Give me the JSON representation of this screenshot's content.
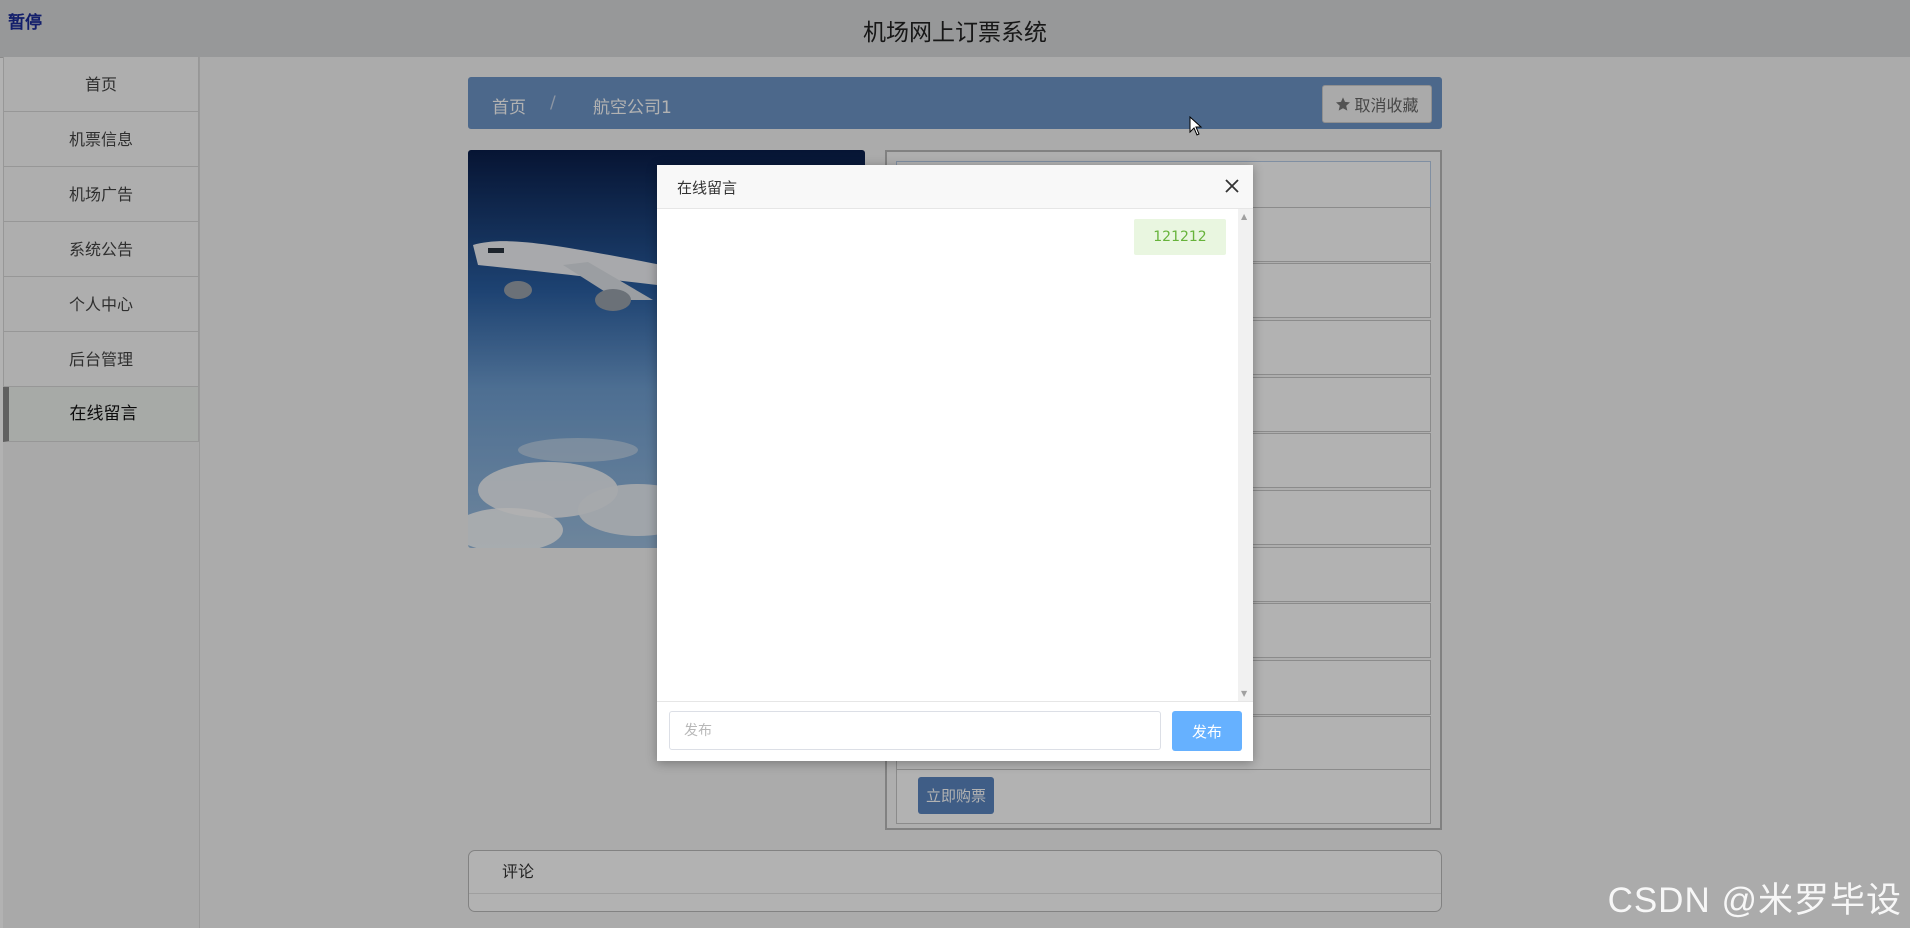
{
  "app": {
    "pause_label": "暂停",
    "title": "机场网上订票系统"
  },
  "sidebar": {
    "items": [
      {
        "label": "首页"
      },
      {
        "label": "机票信息"
      },
      {
        "label": "机场广告"
      },
      {
        "label": "系统公告"
      },
      {
        "label": "个人中心"
      },
      {
        "label": "后台管理"
      },
      {
        "label": "在线留言",
        "active": true
      }
    ]
  },
  "breadcrumb": {
    "items": [
      "首页",
      "航空公司1"
    ],
    "separator": "/",
    "favorite_icon": "star-icon",
    "favorite_label": "取消收藏"
  },
  "detail": {
    "buy_label": "立即购票"
  },
  "comments": {
    "title": "评论"
  },
  "modal": {
    "title": "在线留言",
    "close_icon": "close-icon",
    "messages": [
      {
        "text": "121212"
      }
    ],
    "input_placeholder": "发布",
    "post_label": "发布"
  },
  "watermark": "CSDN @米罗毕设",
  "colors": {
    "breadcrumb_bg": "#6e95c7",
    "post_button": "#66b1ff",
    "message_bubble": "#e9f6e0",
    "message_text": "#67b33b",
    "buy_button": "#5b86c0"
  }
}
